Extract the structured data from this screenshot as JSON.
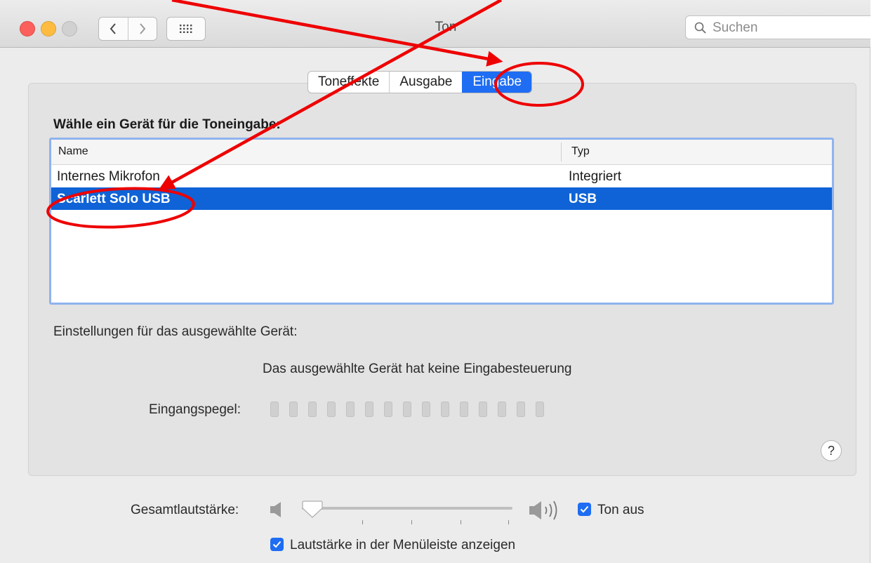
{
  "window": {
    "title": "Ton",
    "search": {
      "placeholder": "Suchen"
    }
  },
  "tabs": [
    {
      "label": "Toneffekte",
      "active": false
    },
    {
      "label": "Ausgabe",
      "active": false
    },
    {
      "label": "Eingabe",
      "active": true
    }
  ],
  "input": {
    "heading": "Wähle ein Gerät für die Toneingabe:",
    "columns": {
      "name": "Name",
      "type": "Typ"
    },
    "devices": [
      {
        "name": "Internes Mikrofon",
        "type": "Integriert",
        "selected": false
      },
      {
        "name": "Scarlett Solo USB",
        "type": "USB",
        "selected": true
      }
    ],
    "settings_label": "Einstellungen für das ausgewählte Gerät:",
    "no_control_message": "Das ausgewählte Gerät hat keine Eingabesteuerung",
    "level_label": "Eingangspegel:",
    "level_segments": 15,
    "input_level": 0
  },
  "volume": {
    "label": "Gesamtlautstärke:",
    "level": 0,
    "mute_label": "Ton aus",
    "mute_checked": true,
    "menubar_label": "Lautstärke in der Menüleiste anzeigen",
    "menubar_checked": true
  },
  "colors": {
    "accent": "#1e6df3",
    "selection": "#0f63d6",
    "annotation": "#ee0000"
  },
  "icons": {
    "help": "?",
    "nav_back": "chevron-left-icon",
    "nav_forward": "chevron-right-icon",
    "grid": "grid-icon",
    "search": "search-icon"
  }
}
